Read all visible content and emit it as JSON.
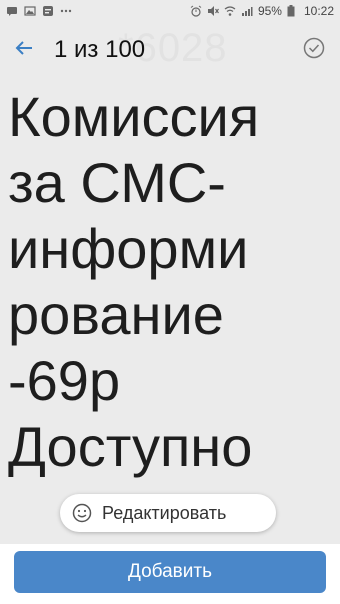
{
  "status_bar": {
    "battery": "95%",
    "time": "10:22",
    "left_icons": [
      "message-icon",
      "image-icon",
      "notification-icon",
      "more-icon"
    ],
    "right_icons": [
      "alarm-icon",
      "mute-icon",
      "wifi-icon",
      "signal-icon",
      "battery-icon"
    ]
  },
  "toolbar": {
    "title": "1 из 100",
    "watermark": "*6028",
    "back_icon": "arrow-left-icon",
    "done_icon": "check-circle-icon"
  },
  "content": {
    "lines": [
      "Комиссия",
      "за СМС-",
      "информи",
      "рование",
      "-69р",
      "Доступно"
    ]
  },
  "edit_chip": {
    "label": "Редактировать",
    "icon": "smiley-icon"
  },
  "add_button": {
    "label": "Добавить"
  },
  "colors": {
    "accent": "#4a87c9",
    "background": "#ebebeb",
    "text": "#1e1e1e"
  }
}
